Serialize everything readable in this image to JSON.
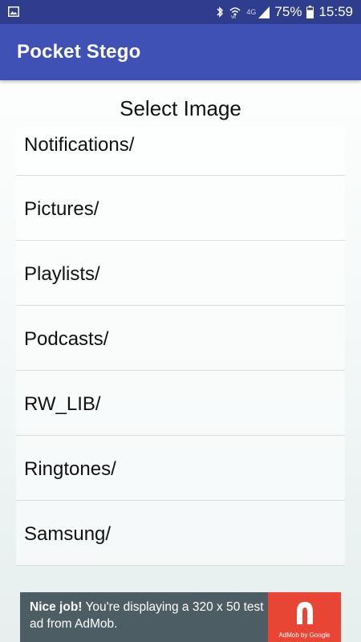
{
  "status_bar": {
    "battery": "75%",
    "time": "15:59",
    "network_label": "4G",
    "icons": [
      "image-notification-icon",
      "bluetooth-icon",
      "wifi-calling-icon",
      "signal-icon",
      "battery-icon"
    ]
  },
  "app_bar": {
    "title": "Pocket Stego",
    "color": "#3f51b5"
  },
  "main": {
    "heading": "Select Image",
    "items": [
      {
        "label": "Notifications/"
      },
      {
        "label": "Pictures/"
      },
      {
        "label": "Playlists/"
      },
      {
        "label": "Podcasts/"
      },
      {
        "label": "RW_LIB/"
      },
      {
        "label": "Ringtones/"
      },
      {
        "label": "Samsung/"
      }
    ]
  },
  "ad": {
    "bold_text": "Nice job!",
    "text": " You're displaying a 320 x 50 test ad from AdMob.",
    "logo_caption": "AdMob by Google",
    "logo_color": "#e84535"
  }
}
